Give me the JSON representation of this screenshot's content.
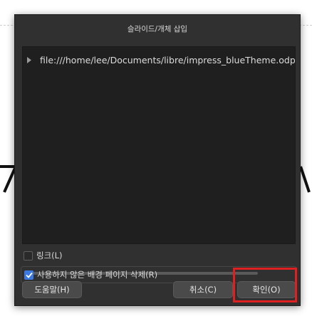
{
  "dialog": {
    "title": "슬라이드/개체 삽입",
    "tree": {
      "items": [
        {
          "label": "file:///home/lee/Documents/libre/impress_blueTheme.odp",
          "icon": "presentation-file-icon",
          "expanded": false
        }
      ]
    },
    "options": {
      "link_label": "링크(L)",
      "link_checked": false,
      "delete_unused_label": "사용하지 않은 배경 페이지 삭제(R)",
      "delete_unused_checked": true
    },
    "buttons": {
      "help": "도움말(H)",
      "cancel": "취소(C)",
      "ok": "확인(O)"
    }
  },
  "annotation": {
    "highlight_color": "#e02020",
    "target": "ok-button"
  },
  "colors": {
    "dialog_bg": "#303030",
    "list_bg": "#1f1f1f",
    "accent": "#3b78e0"
  }
}
